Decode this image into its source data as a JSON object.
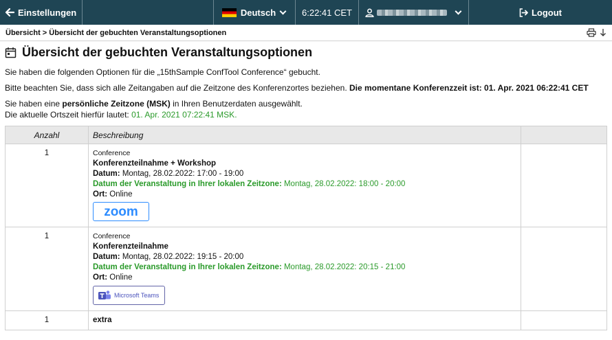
{
  "topbar": {
    "back_label": "Einstellungen",
    "language": "Deutsch",
    "time": "6:22:41 CET",
    "logout_label": "Logout"
  },
  "breadcrumb": {
    "root": "Übersicht",
    "separator": " > ",
    "current": "Übersicht der gebuchten Veranstaltungsoptionen"
  },
  "page": {
    "title": "Übersicht der gebuchten Veranstaltungsoptionen",
    "intro": "Sie haben die folgenden Optionen für die „15thSample ConfTool Conference“ gebucht.",
    "tz_note": "Bitte beachten Sie, dass sich alle Zeitangaben auf die Zeitzone des Konferenzortes beziehen.",
    "tz_now_label": "Die momentane Konferenzzeit ist: 01. Apr. 2021 06:22:41 CET",
    "personal_tz_pre": "Sie haben eine ",
    "personal_tz_bold": "persönliche Zeitzone (MSK)",
    "personal_tz_post": " in Ihren Benutzerdaten ausgewählt.",
    "local_time_label": "Die aktuelle Ortszeit hierfür lautet: ",
    "local_time_value": "01. Apr. 2021 07:22:41 MSK."
  },
  "table": {
    "headers": [
      "Anzahl",
      "Beschreibung",
      ""
    ],
    "rows": [
      {
        "qty": "1",
        "category": "Conference",
        "name": "Konferenzteilnahme + Workshop",
        "date_label": "Datum:",
        "date_value": " Montag, 28.02.2022: 17:00 - 19:00",
        "local_label": "Datum der Veranstaltung in Ihrer lokalen Zeitzone:",
        "local_value": " Montag, 28.02.2022: 18:00 - 20:00",
        "place_label": "Ort:",
        "place_value": " Online",
        "badge": "zoom"
      },
      {
        "qty": "1",
        "category": "Conference",
        "name": "Konferenzteilnahme",
        "date_label": "Datum:",
        "date_value": " Montag, 28.02.2022: 19:15 - 20:00",
        "local_label": "Datum der Veranstaltung in Ihrer lokalen Zeitzone:",
        "local_value": " Montag, 28.02.2022: 20:15 - 21:00",
        "place_label": "Ort:",
        "place_value": " Online",
        "badge": "Microsoft Teams"
      },
      {
        "qty": "1",
        "name": "extra"
      }
    ]
  },
  "colors": {
    "topbar_bg": "#1f4554",
    "accent_green": "#2a9a2a",
    "zoom_blue": "#2d8cff",
    "teams_purple": "#6264a7"
  }
}
